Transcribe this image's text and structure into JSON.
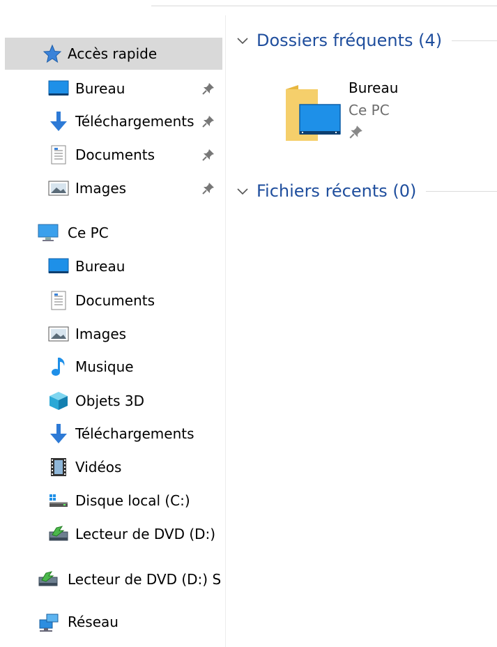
{
  "nav": {
    "quick_access": {
      "label": "Accès rapide",
      "items": [
        {
          "label": "Bureau",
          "icon": "desktop-icon",
          "pinned": true
        },
        {
          "label": "Téléchargements",
          "icon": "downloads-icon",
          "pinned": true
        },
        {
          "label": "Documents",
          "icon": "documents-icon",
          "pinned": true
        },
        {
          "label": "Images",
          "icon": "images-icon",
          "pinned": true
        }
      ]
    },
    "this_pc": {
      "label": "Ce PC",
      "items": [
        {
          "label": "Bureau",
          "icon": "desktop-icon"
        },
        {
          "label": "Documents",
          "icon": "documents-icon"
        },
        {
          "label": "Images",
          "icon": "images-icon"
        },
        {
          "label": "Musique",
          "icon": "music-icon"
        },
        {
          "label": "Objets 3D",
          "icon": "3d-objects-icon"
        },
        {
          "label": "Téléchargements",
          "icon": "downloads-icon"
        },
        {
          "label": "Vidéos",
          "icon": "videos-icon"
        },
        {
          "label": "Disque local (C:)",
          "icon": "local-disk-icon"
        },
        {
          "label": "Lecteur de DVD (D:)",
          "icon": "dvd-drive-icon"
        }
      ]
    },
    "dvd_root": {
      "label": "Lecteur de DVD (D:) S",
      "icon": "dvd-drive-icon"
    },
    "network": {
      "label": "Réseau",
      "icon": "network-icon"
    }
  },
  "main": {
    "frequent": {
      "header": "Dossiers fréquents (4)",
      "tile": {
        "name": "Bureau",
        "location": "Ce PC",
        "pinned": true
      }
    },
    "recent": {
      "header": "Fichiers récents (0)"
    }
  },
  "colors": {
    "accent_text": "#1f4e9d",
    "selected_bg": "#d9d9d9",
    "folder_yellow": "#f2c75c",
    "desktop_blue": "#1e90e8"
  }
}
